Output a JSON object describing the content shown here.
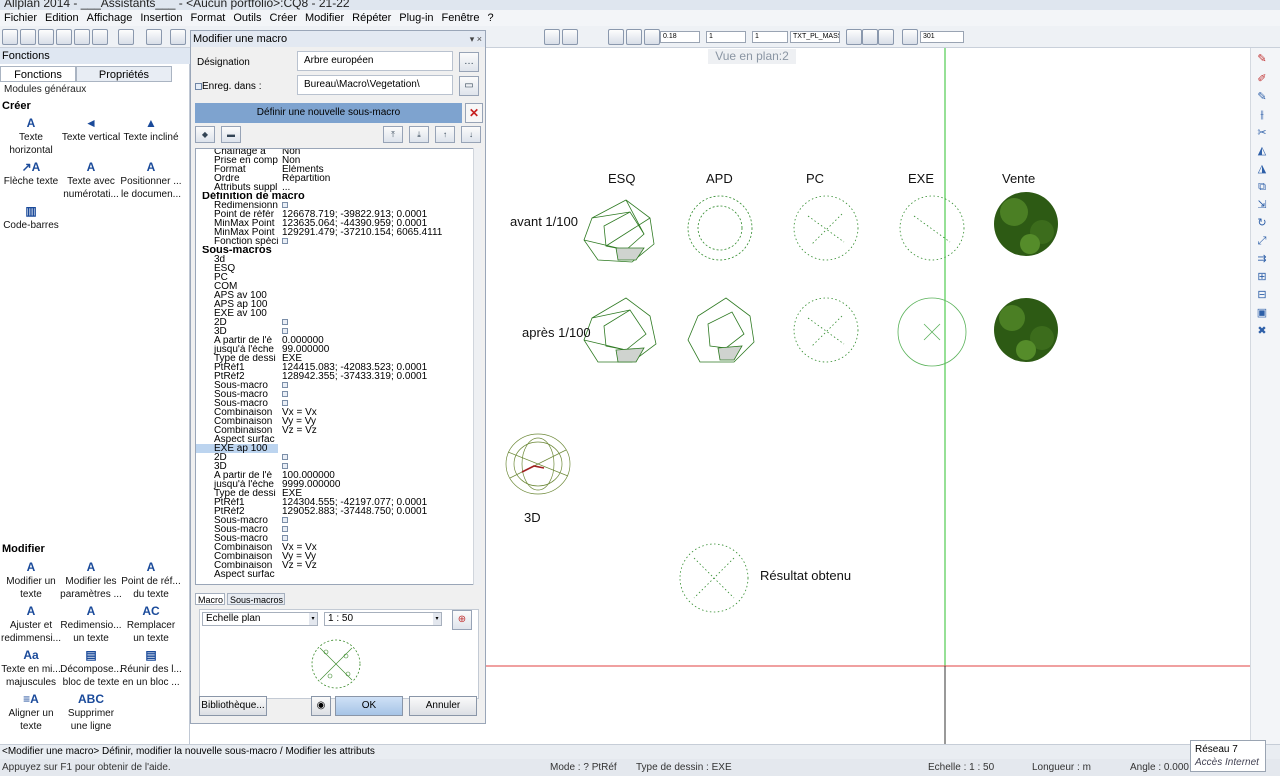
{
  "window": {
    "title": "Allplan 2014 - ___Assistants___ - <Aucun portfolio>:CQ8 - 21-22"
  },
  "menu": [
    "Fichier",
    "Edition",
    "Affichage",
    "Insertion",
    "Format",
    "Outils",
    "Créer",
    "Modifier",
    "Répéter",
    "Plug-in",
    "Fenêtre",
    "?"
  ],
  "toolbar": {
    "pen_thickness": "0.18",
    "line_type": "1",
    "line_color": "1",
    "layer": "TXT_PL_MASSE",
    "scale_field": "301"
  },
  "left_panel": {
    "header": "Fonctions",
    "tabs": [
      "Fonctions",
      "Propriétés"
    ],
    "module": "Modules généraux",
    "section_create": "Créer",
    "create_tools": [
      {
        "label": "Texte horizontal",
        "icon": "A"
      },
      {
        "label": "Texte vertical",
        "icon": "◄"
      },
      {
        "label": "Texte incliné",
        "icon": "▲"
      },
      {
        "label": "Flèche texte",
        "icon": "↗A"
      },
      {
        "label": "Texte avec numérotati...",
        "icon": "A"
      },
      {
        "label": "Positionner ... le documen...",
        "icon": "A"
      },
      {
        "label": "Code-barres",
        "icon": "▥"
      }
    ],
    "section_modify": "Modifier",
    "modify_tools": [
      {
        "label": "Modifier un texte",
        "icon": "A"
      },
      {
        "label": "Modifier les paramètres ...",
        "icon": "A"
      },
      {
        "label": "Point de réf... du texte",
        "icon": "A"
      },
      {
        "label": "Ajuster et redimmensi...",
        "icon": "A"
      },
      {
        "label": "Redimensio... un texte",
        "icon": "A"
      },
      {
        "label": "Remplacer un texte",
        "icon": "AC"
      },
      {
        "label": "Texte en mi... majuscules",
        "icon": "Aa"
      },
      {
        "label": "Décompose... bloc de texte",
        "icon": "▤"
      },
      {
        "label": "Réunir des l... en un bloc ...",
        "icon": "▤"
      },
      {
        "label": "Aligner un texte",
        "icon": "≡A"
      },
      {
        "label": "Supprimer une ligne",
        "icon": "ABC"
      }
    ]
  },
  "dialog": {
    "title": "Modifier une macro",
    "designation_label": "Désignation",
    "designation_value": "Arbre européen",
    "save_label": "Enreg. dans :",
    "save_value": "Bureau\\Macro\\Vegetation\\",
    "define_button": "Définir une nouvelle sous-macro",
    "tree": [
      {
        "n": "Chaînage à",
        "v": "Non"
      },
      {
        "n": "Prise en comp",
        "v": "Non"
      },
      {
        "n": "Format",
        "v": "Eléments"
      },
      {
        "n": "Ordre",
        "v": "Répartition"
      },
      {
        "n": "Attributs suppl",
        "v": "..."
      },
      {
        "n": "Définition de macro",
        "v": "",
        "head": true
      },
      {
        "n": "Redimensionn",
        "v": "",
        "cb": true
      },
      {
        "n": "Point de référ",
        "v": "126678.719; -39822.913; 0.0001"
      },
      {
        "n": "MinMax Point",
        "v": "123635.064; -44390.959; 0.0001"
      },
      {
        "n": "MinMax Point",
        "v": "129291.479; -37210.154; 6065.4111"
      },
      {
        "n": "Fonction spéci",
        "v": "",
        "cb": true
      },
      {
        "n": "Sous-macros",
        "v": "",
        "head": true
      },
      {
        "n": "3d",
        "v": ""
      },
      {
        "n": "ESQ",
        "v": ""
      },
      {
        "n": "PC",
        "v": ""
      },
      {
        "n": "COM",
        "v": ""
      },
      {
        "n": "APS av 100",
        "v": ""
      },
      {
        "n": "APS ap 100",
        "v": ""
      },
      {
        "n": "EXE av 100",
        "v": ""
      },
      {
        "n": "2D",
        "v": "",
        "cb": true
      },
      {
        "n": "3D",
        "v": "",
        "cb": true
      },
      {
        "n": "A partir de l'é",
        "v": "0.000000"
      },
      {
        "n": "jusqu'à l'éche",
        "v": "99.000000"
      },
      {
        "n": "Type de dessi",
        "v": "EXE"
      },
      {
        "n": "PtRéf1",
        "v": "124415.083; -42083.523; 0.0001"
      },
      {
        "n": "PtRéf2",
        "v": "128942.355; -37433.319; 0.0001"
      },
      {
        "n": "Sous-macro",
        "v": "",
        "cb": true
      },
      {
        "n": "Sous-macro",
        "v": "",
        "cb": true
      },
      {
        "n": "Sous-macro",
        "v": "",
        "cb": true
      },
      {
        "n": "Combinaison",
        "v": "Vx = Vx"
      },
      {
        "n": "Combinaison",
        "v": "Vy = Vy"
      },
      {
        "n": "Combinaison",
        "v": "Vz = Vz"
      },
      {
        "n": "Aspect surfac",
        "v": ""
      },
      {
        "n": "EXE ap 100",
        "v": "",
        "sel": true
      },
      {
        "n": "2D",
        "v": "",
        "cb": true
      },
      {
        "n": "3D",
        "v": "",
        "cb": true
      },
      {
        "n": "A partir de l'é",
        "v": "100.000000"
      },
      {
        "n": "jusqu'à l'éche",
        "v": "9999.000000"
      },
      {
        "n": "Type de dessi",
        "v": "EXE"
      },
      {
        "n": "PtRéf1",
        "v": "124304.555; -42197.077; 0.0001"
      },
      {
        "n": "PtRéf2",
        "v": "129052.883; -37448.750; 0.0001"
      },
      {
        "n": "Sous-macro",
        "v": "",
        "cb": true
      },
      {
        "n": "Sous-macro",
        "v": "",
        "cb": true
      },
      {
        "n": "Sous-macro",
        "v": "",
        "cb": true
      },
      {
        "n": "Combinaison",
        "v": "Vx = Vx"
      },
      {
        "n": "Combinaison",
        "v": "Vy = Vy"
      },
      {
        "n": "Combinaison",
        "v": "Vz = Vz"
      },
      {
        "n": "Aspect surfac",
        "v": ""
      }
    ],
    "bottom_tabs": [
      "Macro",
      "Sous-macros"
    ],
    "scale_type": "Echelle plan",
    "scale_value": "1 : 50",
    "library_button": "Bibliothèque...",
    "ok_button": "OK",
    "cancel_button": "Annuler"
  },
  "canvas": {
    "view_label": "Vue en plan:2",
    "columns": [
      "ESQ",
      "APD",
      "PC",
      "EXE",
      "Vente"
    ],
    "row_before": "avant 1/100",
    "row_after": "après 1/100",
    "label_3d": "3D",
    "result_label": "Résultat obtenu",
    "colors": {
      "tree_green": "#3a8a2a",
      "dark_green": "#2d5a14",
      "axis_green": "#2cc22c",
      "axis_red": "#e04040"
    }
  },
  "status": {
    "prompt": "<Modifier une macro> Définir, modifier la nouvelle sous-macro / Modifier les attributs",
    "help": "Appuyez sur F1 pour obtenir de l'aide.",
    "mode": "Mode : ? PtRéf",
    "drawing_type": "Type de dessin : EXE",
    "scale": "Echelle : 1 : 50",
    "length": "Longueur : m",
    "angle": "Angle : 0.000",
    "network": "Réseau",
    "network_count": "7",
    "internet": "Accès Internet"
  }
}
